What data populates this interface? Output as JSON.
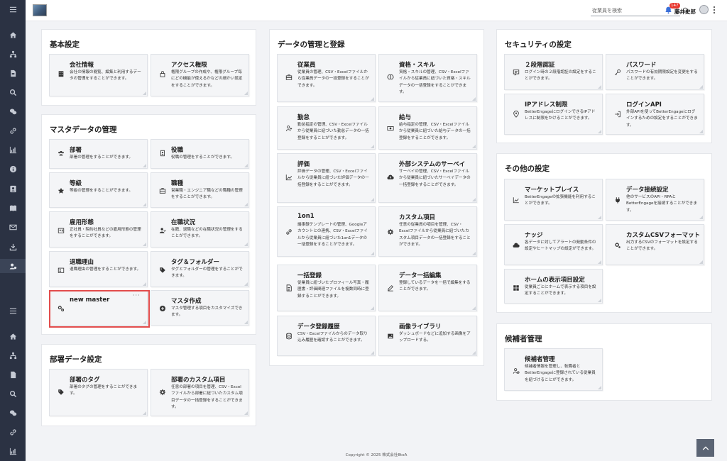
{
  "header": {
    "search_placeholder": "従業員を検索",
    "notification_count": "147",
    "username": "藤井史郎"
  },
  "sections": {
    "basic": {
      "title": "基本設定",
      "tiles": [
        {
          "icon": "building-icon",
          "title": "会社情報",
          "desc": "会社の情報の閲覧、編集と利用するデータの管理をすることができます。"
        },
        {
          "icon": "lock-icon",
          "title": "アクセス権限",
          "desc": "権限グループの作成や、権限グループ毎にどの機能が使えるかなどの細かい設定をすることができます。"
        }
      ]
    },
    "master": {
      "title": "マスタデータの管理",
      "tiles": [
        {
          "icon": "people-icon",
          "title": "部署",
          "desc": "部署の管理をすることができます。"
        },
        {
          "icon": "id-badge-icon",
          "title": "役職",
          "desc": "役職の管理をすることができます。"
        },
        {
          "icon": "star-icon",
          "title": "等級",
          "desc": "等級の管理をすることができます。"
        },
        {
          "icon": "briefcase-icon",
          "title": "職種",
          "desc": "営業職・エンジニア職などの職種の管理をすることができます。"
        },
        {
          "icon": "id-card-icon",
          "title": "雇用形態",
          "desc": "正社員・契約社員などの雇用形態の管理をすることができます。"
        },
        {
          "icon": "user-status-icon",
          "title": "在職状況",
          "desc": "在籍、退職などの在職状況の管理をすることができます。"
        },
        {
          "icon": "user-card-icon",
          "title": "退職理由",
          "desc": "退職理由の管理をすることができます。"
        },
        {
          "icon": "tag-icon",
          "title": "タグ＆フォルダー",
          "desc": "タグとフォルダーの管理をすることができます。"
        },
        {
          "icon": "gears-icon",
          "title": "new master",
          "desc": ""
        },
        {
          "icon": "plus-circle-icon",
          "title": "マスタ作成",
          "desc": "マスタ管理する項目をカスタマイズできます。"
        }
      ]
    },
    "dept": {
      "title": "部署データ設定",
      "tiles": [
        {
          "icon": "tag-icon",
          "title": "部署のタグ",
          "desc": "部署のタグの管理をすることができます。"
        },
        {
          "icon": "gear-icon",
          "title": "部署のカスタム項目",
          "desc": "任意の部署の項目を管理、CSV・Excelファイルから部署に紐づいたカスタム項目データの一括登録をすることができます。"
        }
      ]
    },
    "data": {
      "title": "データの管理と登録",
      "tiles": [
        {
          "icon": "briefcase-icon",
          "title": "従業員",
          "desc": "従業員の管理、CSV・Excelファイルから従業員データの一括登録をすることができます。"
        },
        {
          "icon": "brain-icon",
          "title": "資格・スキル",
          "desc": "資格・スキルの管理、CSV・Excelファイルから従業員に紐づいた資格・スキルデータの一括登録をすることができます。"
        },
        {
          "icon": "user-plus-icon",
          "title": "勤怠",
          "desc": "勤怠指定の管理、CSV・Excelファイルから従業員に紐づいた勤怠データの一括登録をすることができます。"
        },
        {
          "icon": "money-icon",
          "title": "給与",
          "desc": "給与指定の管理、CSV・Excelファイルから従業員に紐づいた給与データの一括登録をすることができます。"
        },
        {
          "icon": "chart-icon",
          "title": "評価",
          "desc": "評価データの管理、CSV・Excelファイルから従業員に紐づいた評価データの一括登録をすることができます。"
        },
        {
          "icon": "cloud-upload-icon",
          "title": "外部システムのサーベイ",
          "desc": "サーベイの管理、CSV・Excelファイルから従業員に紐づいたサーベイデータの一括登録をすることができます。"
        },
        {
          "icon": "link-icon",
          "title": "1on1",
          "desc": "議事録テンプレートの管理、Googleアカウントとの連携、CSV・Excelファイルから従業員に紐づいた1on1データの一括登録をすることができます。"
        },
        {
          "icon": "gear-icon",
          "title": "カスタム項目",
          "desc": "任意の従業員の項目を管理、CSV・Excelファイルから従業員に紐づいたカスタム項目データの一括登録をすることができます。"
        },
        {
          "icon": "document-icon",
          "title": "一括登録",
          "desc": "従業員に紐づいたプロフィール写真・履歴書・評価関連ファイルを複数同時に登録することができます。"
        },
        {
          "icon": "pen-icon",
          "title": "データ一括編集",
          "desc": "登録しているデータを一括で編集をすることができます。"
        },
        {
          "icon": "database-icon",
          "title": "データ登録履歴",
          "desc": "CSV・Excelファイルからのデータ取り込み履歴を確認することができます。"
        },
        {
          "icon": "image-icon",
          "title": "画像ライブラリ",
          "desc": "ダッシュボードなどに追加する画像をアップロードする。"
        }
      ]
    },
    "security": {
      "title": "セキュリティの設定",
      "tiles": [
        {
          "icon": "message-icon",
          "title": "２段階認証",
          "desc": "ログイン時の２段階認証の設定をすることができます。"
        },
        {
          "icon": "key-icon",
          "title": "パスワード",
          "desc": "パスワードの有効期限設定を変更をすることができます。"
        },
        {
          "icon": "location-icon",
          "title": "IPアドレス制限",
          "desc": "BetterEngageにログインできるIPアドレスに制限をかけることができます。"
        },
        {
          "icon": "login-icon",
          "title": "ログインAPI",
          "desc": "外部APIを使ってBetterEngageにログインするための設定をすることができます。"
        }
      ]
    },
    "other": {
      "title": "その他の設定",
      "tiles": [
        {
          "icon": "trend-icon",
          "title": "マーケットプレイス",
          "desc": "BetterEngageの拡張機能を利用することができます。"
        },
        {
          "icon": "plug-icon",
          "title": "データ接続設定",
          "desc": "他のサービスのAPI・RPAとBetterEngageを接続することができます。"
        },
        {
          "icon": "cloud-icon",
          "title": "ナッジ",
          "desc": "各データに対してアラートの発動条件の設定やヒートマップの設定ができます。"
        },
        {
          "icon": "csv-gear-icon",
          "title": "カスタムCSVフォーマット",
          "desc": "出力するCSVのフォーマットを設定することができます。"
        },
        {
          "icon": "grid-icon",
          "title": "ホームの表示項目設定",
          "desc": "従業員ごとにホームで表示する項目を設定することができます。"
        }
      ]
    },
    "candidate": {
      "title": "候補者管理",
      "tiles": [
        {
          "icon": "user-gear-icon",
          "title": "候補者管理",
          "desc": "候補者情報を管理し、転職者とBetterEngageに登録されている従業員を紐づけることができます。"
        }
      ]
    }
  },
  "footer": {
    "copyright": "Copyright © 2025 株式会社BtoA"
  }
}
